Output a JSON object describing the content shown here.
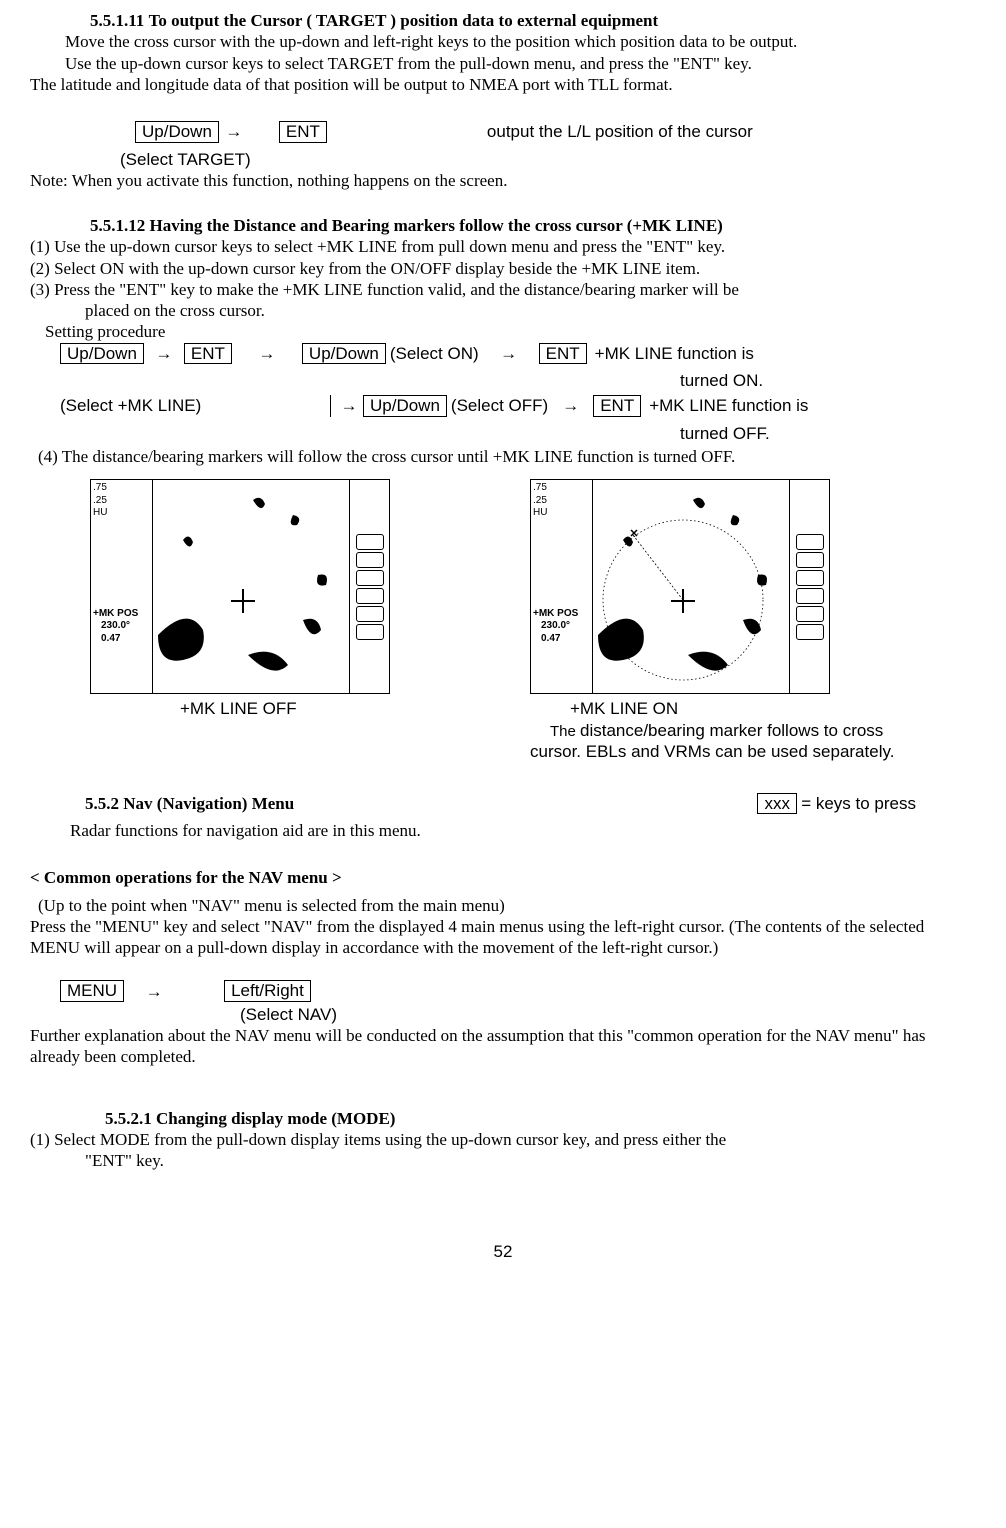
{
  "s1": {
    "num": "5.5.1.11",
    "title": "To output the Cursor ( TARGET ) position data to external equipment",
    "p1": "Move the cross cursor with the up-down and left-right keys to the position which position data to be output.",
    "p2": "Use the up-down cursor keys to select TARGET from the pull-down menu, and press the \"ENT\" key.",
    "p3": "The latitude and longitude data of that position will be output to NMEA port with TLL format.",
    "key1": "Up/Down",
    "key2": "ENT",
    "result": "output the L/L position of the cursor",
    "sel": "(Select TARGET)",
    "note": "Note: When you activate this function, nothing happens on the screen."
  },
  "s2": {
    "num": "5.5.1.12",
    "title": "Having the Distance and Bearing markers follow the cross cursor (+MK LINE)",
    "l1": "(1)  Use the up-down cursor keys to select +MK LINE from pull down menu and press the \"ENT\" key.",
    "l2": "(2)  Select ON with the up-down cursor key from the ON/OFF display beside the +MK LINE item.",
    "l3a": "(3)  Press the \"ENT\" key to make the +MK LINE function valid, and the distance/bearing marker will be",
    "l3b": "placed on the cross cursor.",
    "setproc": "Setting procedure",
    "k_ud": "Up/Down",
    "k_ent": "ENT",
    "sel_on": "(Select ON)",
    "sel_off": "(Select OFF)",
    "sel_mk": "(Select +MK LINE)",
    "res_on1": "+MK LINE function is",
    "res_on2": "turned ON.",
    "res_off1": "+MK LINE function is",
    "res_off2": "turned OFF.",
    "l4": "(4) The distance/bearing markers will follow the cross cursor until +MK LINE function is turned OFF."
  },
  "radar": {
    "t1": ".75",
    "t2": ".25",
    "t3": "HU",
    "mk": "+MK POS",
    "brg": "230.0°",
    "dist": "0.47",
    "cap_off": "+MK LINE   OFF",
    "cap_on": "+MK LINE   ON",
    "desc1": "The distance/bearing marker follows to cross",
    "desc2": "cursor. EBLs and VRMs can be used separately."
  },
  "s3": {
    "num": "5.5.2",
    "title": "Nav (Navigation) Menu",
    "keyhint_box": "xxx",
    "keyhint": " = keys to press",
    "p1": "Radar functions for navigation aid are in this menu.",
    "h2": "< Common operations for the NAV menu >",
    "p2": "(Up to the point when \"NAV\" menu is selected from the main menu)",
    "p3": "Press the \"MENU\" key and select \"NAV\" from the displayed 4 main menus using the left-right cursor.  (The contents of the selected MENU will appear on a pull-down display in accordance with the movement of the left-right cursor.)",
    "k_menu": "MENU",
    "k_lr": "Left/Right",
    "sel_nav": "(Select NAV)",
    "p4": "Further explanation about the NAV menu will be conducted on the assumption that this \"common operation for the NAV menu\" has already been completed."
  },
  "s4": {
    "num": "5.5.2.1",
    "title": "Changing display mode  (MODE)",
    "l1a": "(1)  Select MODE from the pull-down display items using the up-down cursor key, and press either the",
    "l1b": "\"ENT\" key."
  },
  "page": "52",
  "arrow": "→"
}
